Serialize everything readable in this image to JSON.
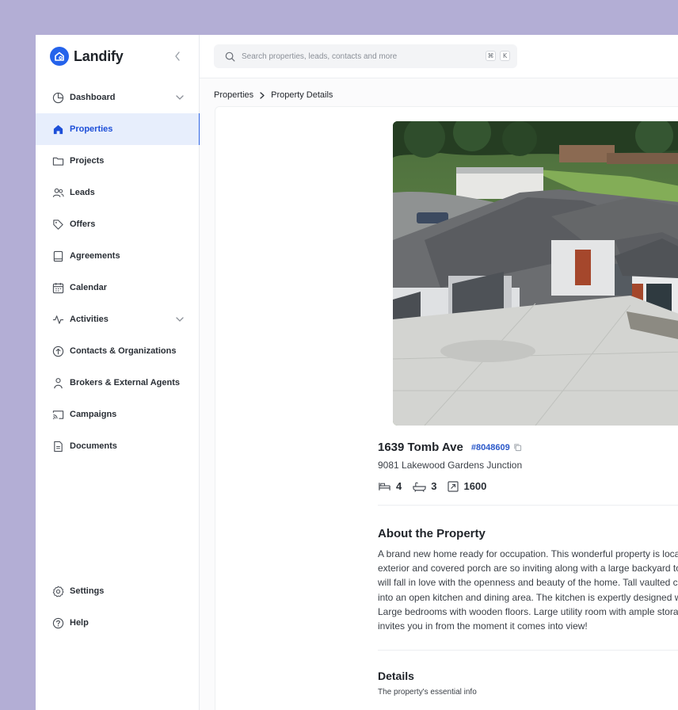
{
  "app": {
    "name": "Landify"
  },
  "sidebar": {
    "items": [
      {
        "key": "dashboard",
        "label": "Dashboard",
        "icon": "pie-chart-icon",
        "chevron": true
      },
      {
        "key": "properties",
        "label": "Properties",
        "icon": "home-icon",
        "active": true
      },
      {
        "key": "projects",
        "label": "Projects",
        "icon": "folder-icon"
      },
      {
        "key": "leads",
        "label": "Leads",
        "icon": "users-icon"
      },
      {
        "key": "offers",
        "label": "Offers",
        "icon": "tag-icon"
      },
      {
        "key": "agreements",
        "label": "Agreements",
        "icon": "book-icon"
      },
      {
        "key": "calendar",
        "label": "Calendar",
        "icon": "calendar-icon"
      },
      {
        "key": "activities",
        "label": "Activities",
        "icon": "activity-icon",
        "chevron": true
      },
      {
        "key": "contacts",
        "label": "Contacts & Organizations",
        "icon": "circle-arrow-icon"
      },
      {
        "key": "brokers",
        "label": "Brokers & External Agents",
        "icon": "user-icon"
      },
      {
        "key": "campaigns",
        "label": "Campaigns",
        "icon": "cast-icon"
      },
      {
        "key": "documents",
        "label": "Documents",
        "icon": "file-icon"
      }
    ],
    "bottom": [
      {
        "key": "settings",
        "label": "Settings",
        "icon": "gear-icon"
      },
      {
        "key": "help",
        "label": "Help",
        "icon": "help-icon"
      }
    ]
  },
  "search": {
    "placeholder": "Search properties, leads, contacts and more",
    "shortcut_mod": "⌘",
    "shortcut_key": "K"
  },
  "breadcrumb": {
    "parent": "Properties",
    "current": "Property Details"
  },
  "property": {
    "title": "1639 Tomb Ave",
    "id": "#8048609",
    "address": "9081 Lakewood Gardens Junction",
    "beds": "4",
    "baths": "3",
    "area": "1600"
  },
  "about": {
    "heading": "About the Property",
    "lines": [
      "A brand new home ready for occupation. This wonderful property is located in a prime location. The char",
      "exterior and covered porch are so inviting along with a large backyard to enjoy with deck. Once you enter",
      "will fall in love with the openness and beauty of the home. Tall vaulted ceiling is in the family room which",
      "into an open kitchen and dining area. The kitchen is expertly designed with a huge island and granite cou",
      "Large bedrooms with wooden floors. Large utility room with ample storage and natural light. This propert",
      "invites you in from the moment it comes into view!"
    ]
  },
  "details": {
    "heading": "Details",
    "subtitle": "The property's essential info"
  },
  "colors": {
    "accent": "#2563eb",
    "active_bg": "#e7eefc",
    "backdrop": "#b3aed5"
  }
}
